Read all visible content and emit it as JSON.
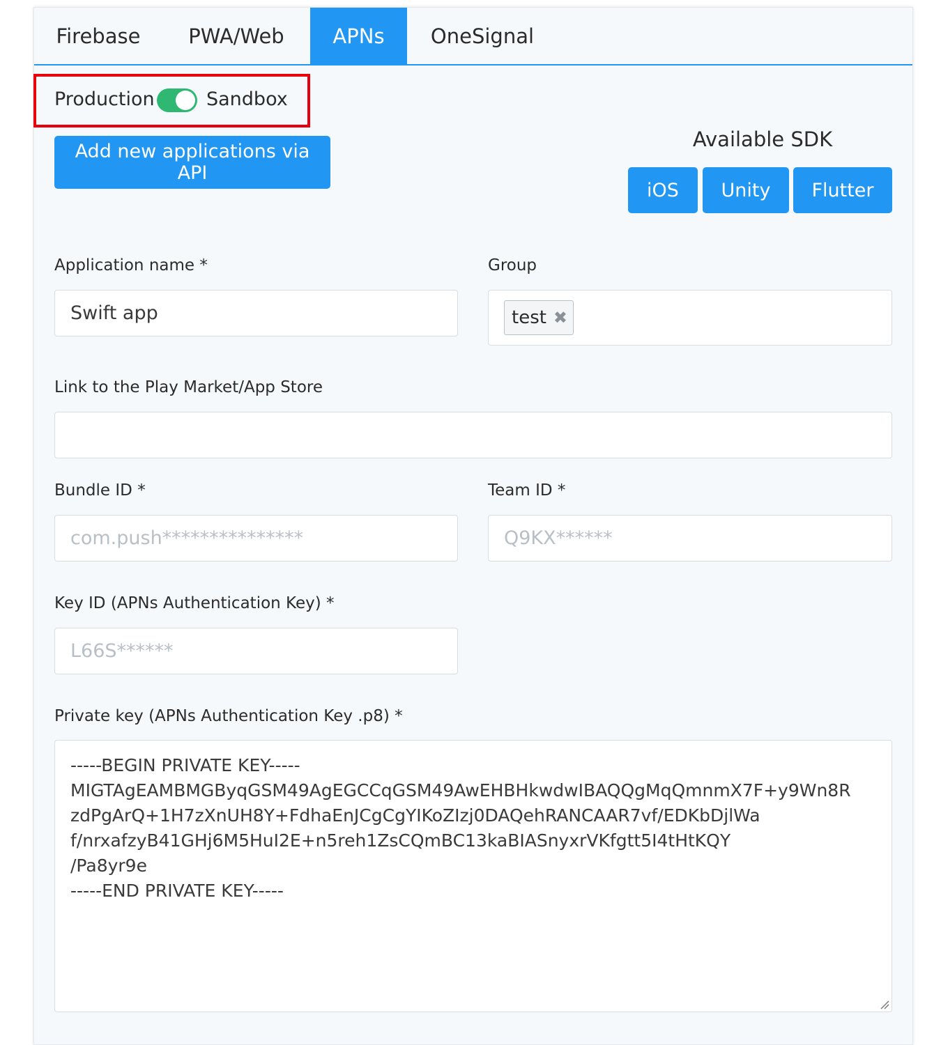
{
  "tabs": [
    {
      "label": "Firebase",
      "active": false
    },
    {
      "label": "PWA/Web",
      "active": false
    },
    {
      "label": "APNs",
      "active": true
    },
    {
      "label": "OneSignal",
      "active": false
    }
  ],
  "environment": {
    "left_label": "Production",
    "right_label": "Sandbox",
    "selected": "Sandbox"
  },
  "add_button_label": "Add new applications via API",
  "sdk": {
    "title": "Available SDK",
    "buttons": [
      "iOS",
      "Unity",
      "Flutter"
    ]
  },
  "form": {
    "app_name": {
      "label": "Application name *",
      "value": "Swift app"
    },
    "group": {
      "label": "Group",
      "tags": [
        "test"
      ],
      "remove_glyph": "✖"
    },
    "store_link": {
      "label": "Link to the Play Market/App Store",
      "value": ""
    },
    "bundle_id": {
      "label": "Bundle ID *",
      "placeholder": "com.push***************"
    },
    "team_id": {
      "label": "Team ID *",
      "placeholder": "Q9KX******"
    },
    "key_id": {
      "label": "Key ID (APNs Authentication Key) *",
      "placeholder": "L66S******"
    },
    "private_key": {
      "label": "Private key (APNs Authentication Key .p8) *",
      "value": "-----BEGIN PRIVATE KEY-----\nMIGTAgEAMBMGByqGSM49AgEGCCqGSM49AwEHBHkwdwIBAQQgMqQmnmX7F+y9Wn8R\nzdPgArQ+1H7zXnUH8Y+FdhaEnJCgCgYIKoZIzj0DAQehRANCAAR7vf/EDKbDjlWa\nf/nrxafzyB41GHj6M5HuI2E+n5reh1ZsCQmBC13kaBIASnyxrVKfgtt5I4tHtKQY\n/Pa8yr9e\n-----END PRIVATE KEY-----"
    }
  },
  "colors": {
    "accent": "#2196f3",
    "toggle_on": "#2eb872",
    "highlight": "#e8000b"
  }
}
